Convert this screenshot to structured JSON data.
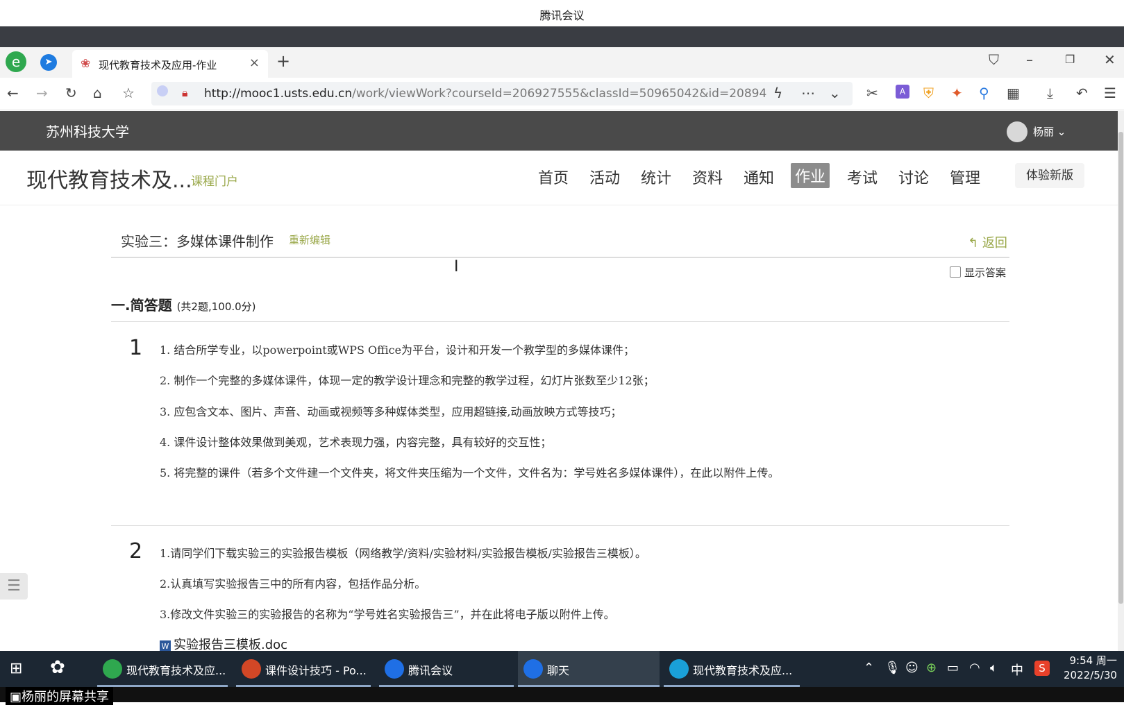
{
  "meeting": {
    "title": "腾讯会议"
  },
  "browser": {
    "tab_title": "现代教育技术及应用-作业",
    "tab_close": "×",
    "new_tab": "+",
    "url_host": "http://mooc1.usts.edu.cn",
    "url_path": "/work/viewWork?courseId=206927555&classId=50965042&id=20894"
  },
  "site": {
    "university": "苏州科技大学",
    "user": "杨丽",
    "course_title": "现代教育技术及...",
    "course_portal": "课程门户",
    "nav": [
      "首页",
      "活动",
      "统计",
      "资料",
      "通知",
      "作业",
      "考试",
      "讨论",
      "管理"
    ],
    "active_nav": "作业",
    "new_version": "体验新版"
  },
  "homework": {
    "title": "实验三：多媒体课件制作",
    "re_edit": "重新编辑",
    "back": "返回",
    "show_answer": "显示答案",
    "section_title": "一.简答题",
    "section_meta": "(共2题,100.0分)",
    "questions": [
      {
        "number": "1",
        "lines": [
          "1.   结合所学专业，以powerpoint或WPS Office为平台，设计和开发一个教学型的多媒体课件；",
          "2.  制作一个完整的多媒体课件，体现一定的教学设计理念和完整的教学过程，幻灯片张数至少12张；",
          "3.  应包含文本、图片、声音、动画或视频等多种媒体类型，应用超链接,动画放映方式等技巧；",
          "4.  课件设计整体效果做到美观，艺术表现力强，内容完整，具有较好的交互性；",
          "5.  将完整的课件（若多个文件建一个文件夹，将文件夹压缩为一个文件，文件名为：学号姓名多媒体课件），在此以附件上传。"
        ]
      },
      {
        "number": "2",
        "lines": [
          "1.请同学们下载实验三的实验报告模板（网络教学/资料/实验材料/实验报告模板/实验报告三模板）。",
          "2.认真填写实验报告三中的所有内容，包括作品分析。",
          "3.修改文件实验三的实验报告的名称为“学号姓名实验报告三”，并在此将电子版以附件上传。"
        ],
        "attachment": "实验报告三模板.doc"
      }
    ]
  },
  "taskbar": {
    "apps": [
      {
        "label": "现代教育技术及应...",
        "color": "#2fa84f"
      },
      {
        "label": "课件设计技巧 - Po...",
        "color": "#d24726"
      },
      {
        "label": "腾讯会议",
        "color": "#1f6fe5"
      },
      {
        "label": "聊天",
        "color": "#1f6fe5"
      },
      {
        "label": "现代教育技术及应...",
        "color": "#1aa0d8"
      }
    ],
    "ime": "中",
    "time": "9:54 周一",
    "date": "2022/5/30"
  },
  "share_label": "杨丽的屏幕共享"
}
